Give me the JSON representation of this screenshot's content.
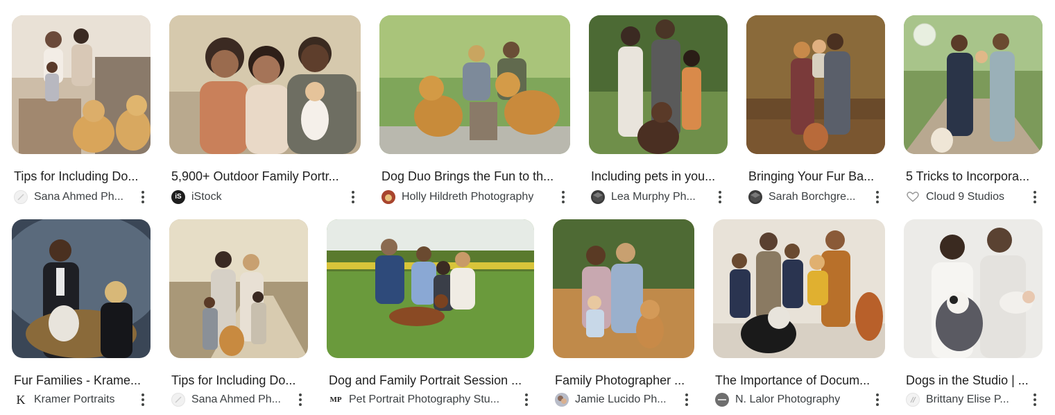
{
  "results": [
    {
      "title": "Tips for Including Do...",
      "source": "Sana Ahmed Ph...",
      "source_icon": "sana-ahmed-logo-icon"
    },
    {
      "title": "5,900+ Outdoor Family Portr...",
      "source": "iStock",
      "source_icon": "istock-logo-icon"
    },
    {
      "title": "Dog Duo Brings the Fun to th...",
      "source": "Holly Hildreth Photography",
      "source_icon": "holly-hildreth-logo-icon"
    },
    {
      "title": "Including pets in you...",
      "source": "Lea Murphy Ph...",
      "source_icon": "lea-murphy-logo-icon"
    },
    {
      "title": "Bringing Your Fur Ba...",
      "source": "Sarah Borchgre...",
      "source_icon": "sarah-borchgrevink-logo-icon"
    },
    {
      "title": "5 Tricks to Incorpora...",
      "source": "Cloud 9 Studios",
      "source_icon": "heart-icon"
    },
    {
      "title": "Fur Families - Krame...",
      "source": "Kramer Portraits",
      "source_icon": "kramer-k-logo-icon"
    },
    {
      "title": "Tips for Including Do...",
      "source": "Sana Ahmed Ph...",
      "source_icon": "sana-ahmed-logo-icon"
    },
    {
      "title": "Dog and Family Portrait Session ...",
      "source": "Pet Portrait Photography Stu...",
      "source_icon": "pet-portrait-logo-icon"
    },
    {
      "title": "Family Photographer ...",
      "source": "Jamie Lucido Ph...",
      "source_icon": "jamie-lucido-logo-icon"
    },
    {
      "title": "The Importance of Docum...",
      "source": "N. Lalor Photography",
      "source_icon": "n-lalor-logo-icon"
    },
    {
      "title": "Dogs in the Studio | ...",
      "source": "Brittany Elise P...",
      "source_icon": "brittany-elise-logo-icon"
    }
  ],
  "logo_text": {
    "istock": "iS",
    "kramer": "K",
    "pet_portrait": "MP"
  },
  "colors": {
    "text": "#1f1f1f",
    "source_text": "#3c4043",
    "more_dots": "#444746"
  }
}
